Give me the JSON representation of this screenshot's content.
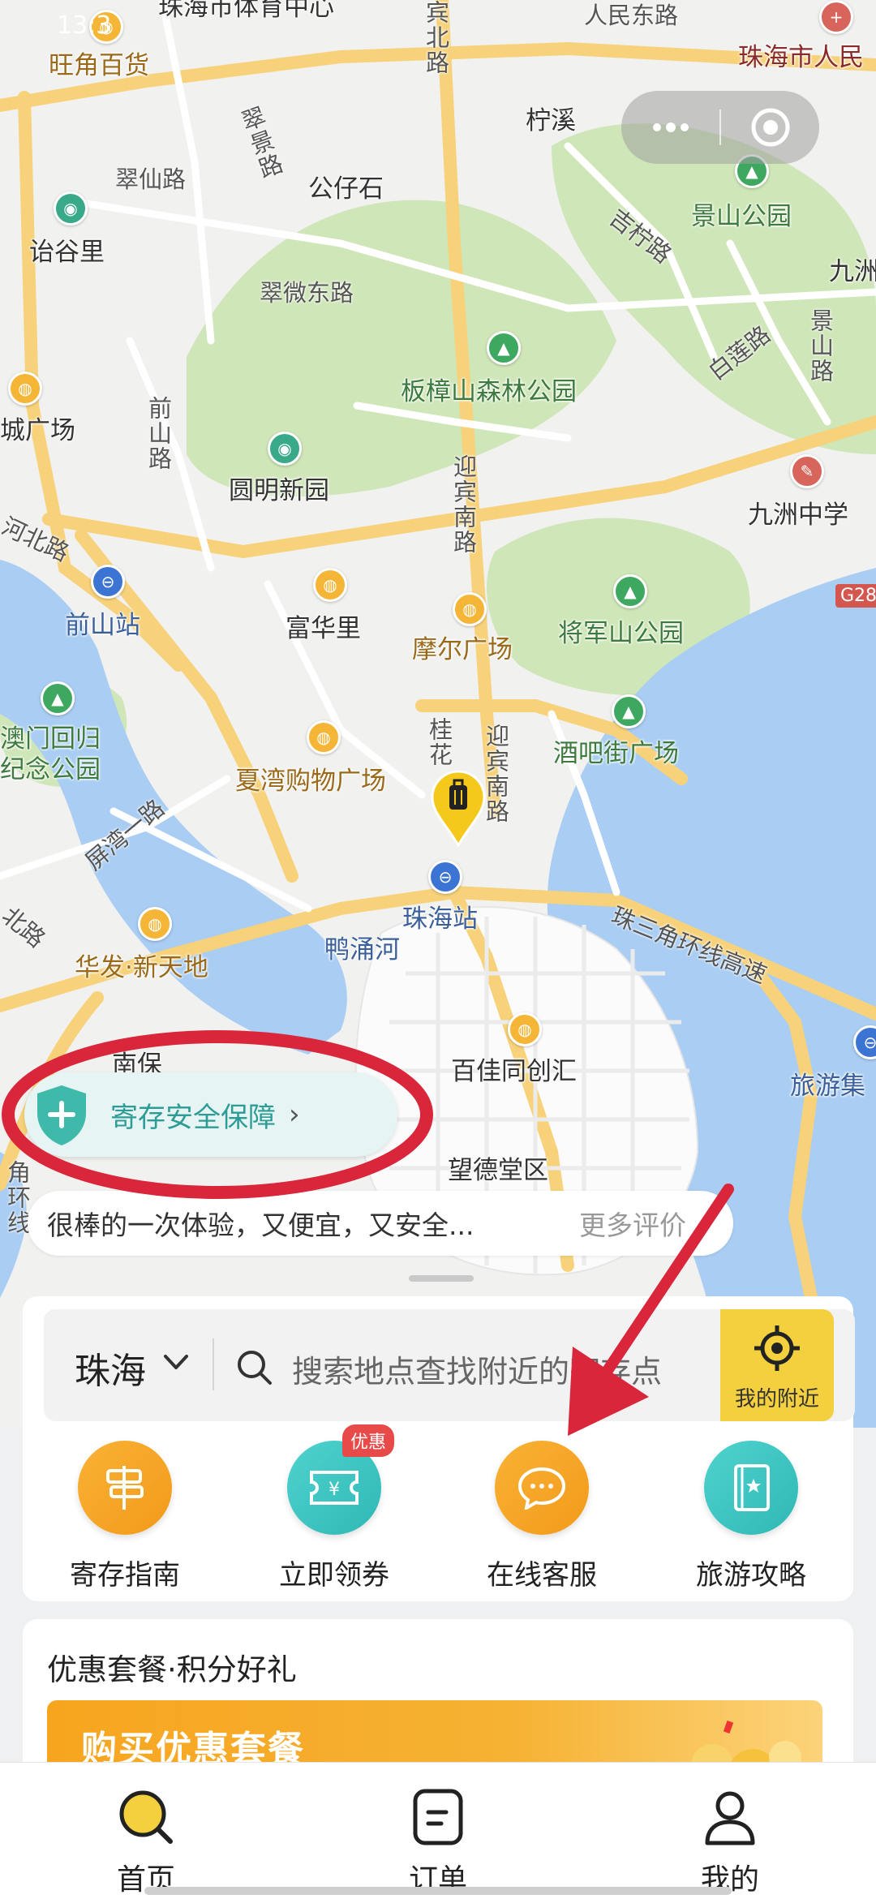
{
  "status_bar": {
    "time": "13:3"
  },
  "capsule": {
    "more_icon": "more-dots-icon",
    "close_icon": "target-circle-icon"
  },
  "map": {
    "pois": [
      {
        "label": "珠海市体育中心"
      },
      {
        "label": "旺角百货"
      },
      {
        "label": "人民东路"
      },
      {
        "label": "珠海市人民"
      },
      {
        "label": "柠溪"
      },
      {
        "label": "翠仙路"
      },
      {
        "label": "公仔石"
      },
      {
        "label": "诒谷里"
      },
      {
        "label": "景山公园"
      },
      {
        "label": "九洲"
      },
      {
        "label": "翠微东路"
      },
      {
        "label": "板樟山森林公园"
      },
      {
        "label": "城广场"
      },
      {
        "label": "圆明新园"
      },
      {
        "label": "九洲中学"
      },
      {
        "label": "前山站"
      },
      {
        "label": "富华里"
      },
      {
        "label": "将军山公园"
      },
      {
        "label": "摩尔广场"
      },
      {
        "label": "澳门回归"
      },
      {
        "label": "纪念公园"
      },
      {
        "label": "夏湾购物广场"
      },
      {
        "label": "酒吧街广场"
      },
      {
        "label": "珠海站"
      },
      {
        "label": "鸭涌河"
      },
      {
        "label": "华发·新天地"
      },
      {
        "label": "百佳同创汇"
      },
      {
        "label": "旅游集"
      },
      {
        "label": "南保"
      },
      {
        "label": "望德堂区"
      },
      {
        "label": "G28"
      }
    ],
    "roads": [
      {
        "label": "宾北路"
      },
      {
        "label": "翠景路"
      },
      {
        "label": "吉柠路"
      },
      {
        "label": "白莲路"
      },
      {
        "label": "景山路"
      },
      {
        "label": "前山路"
      },
      {
        "label": "迎宾南路"
      },
      {
        "label": "河北路"
      },
      {
        "label": "桂花"
      },
      {
        "label": "迎宾南路"
      },
      {
        "label": "屏湾一路"
      },
      {
        "label": "珠三角环线高速"
      },
      {
        "label": "北路"
      },
      {
        "label": "角环线"
      }
    ]
  },
  "safety_banner": {
    "label": "寄存安全保障",
    "icon": "shield-plus-icon"
  },
  "review": {
    "text": "很棒的一次体验，又便宜，又安全...",
    "more": "更多评价"
  },
  "search": {
    "city": "珠海",
    "placeholder": "搜索地点查找附近的寄存点",
    "nearby_label": "我的附近"
  },
  "quick_actions": [
    {
      "label": "寄存指南",
      "icon": "signpost-icon",
      "color": "#f5a623"
    },
    {
      "label": "立即领券",
      "icon": "coupon-icon",
      "color": "#3cc6c3",
      "badge": "优惠"
    },
    {
      "label": "在线客服",
      "icon": "chat-bubble-icon",
      "color": "#f5a623"
    },
    {
      "label": "旅游攻略",
      "icon": "guide-book-icon",
      "color": "#3cc6c3"
    }
  ],
  "promo": {
    "title": "优惠套餐·积分好礼",
    "banner_text": "购买优惠套餐"
  },
  "tabs": [
    {
      "label": "首页",
      "active": true
    },
    {
      "label": "订单",
      "active": false
    },
    {
      "label": "我的",
      "active": false
    }
  ],
  "colors": {
    "accent": "#f4d03f",
    "teal": "#3cc6c3",
    "orange": "#f5a623",
    "annotation_red": "#d9263a"
  }
}
